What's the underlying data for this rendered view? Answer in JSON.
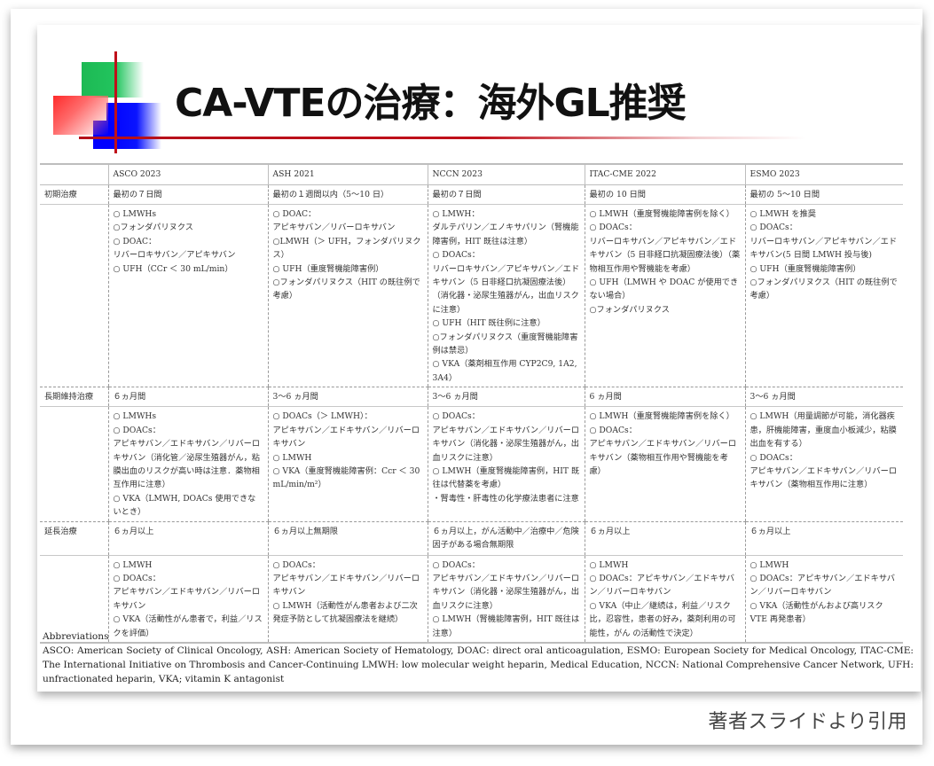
{
  "slide": {
    "title": "CA-VTEの治療：海外GL推奨",
    "colors": {
      "green": "#22c55e",
      "red": "#ff2b2b",
      "blue": "#0000ff",
      "rule": "#c0101a"
    }
  },
  "table": {
    "headers": [
      "",
      "ASCO 2023",
      "ASH 2021",
      "NCCN 2023",
      "ITAC-CME 2022",
      "ESMO 2023"
    ],
    "sections": [
      {
        "phase": "初期治療",
        "durations": [
          "最初の７日間",
          "最初の１週間以内（5～10 日）",
          "最初の７日間",
          "最初の 10 日間",
          "最初の 5～10 日間"
        ],
        "treatments": [
          [
            "○ LMWHs",
            "○フォンダパリヌクス",
            "○ DOAC：",
            "リバーロキサバン／アピキサバン",
            "○ UFH（CCr ＜ 30 mL/min）"
          ],
          [
            "○ DOAC：",
            "アピキサバン／リバーロキサバン",
            "○LMWH（＞ UFH，フォンダパリヌクス）",
            "○ UFH（重度腎機能障害例）",
            "○フォンダパリヌクス（HIT の既往例で考慮）"
          ],
          [
            "○ LMWH：",
            "ダルテパリン／エノキサパリン（腎機能障害例，HIT 既往は注意）",
            "○ DOACs：",
            "リバーロキサバン／アピキサバン／エドキサバン（5 日非経口抗凝固療法後）（消化器・泌尿生殖器がん，出血リスクに注意）",
            "○ UFH（HIT 既往例に注意）",
            "○フォンダパリヌクス（重度腎機能障害例は禁忌）",
            "○ VKA（薬剤相互作用 CYP2C9, 1A2, 3A4）"
          ],
          [
            "○ LMWH（重度腎機能障害例を除く）",
            "○ DOACs：",
            "リバーロキサバン／アピキサバン／エドキサバン（5 日非経口抗凝固療法後）（薬物相互作用や腎機能を考慮）",
            "○ UFH（LMWH や DOAC が使用できない場合）",
            "○フォンダパリヌクス"
          ],
          [
            "○ LMWH を推奨",
            "○ DOACs：",
            "リバーロキサバン／アピキサバン／エドキサバン(5 日間 LMWH 投与後)",
            "○ UFH（重度腎機能障害例）",
            "○フォンダパリヌクス（HIT の既往例で考慮）"
          ]
        ]
      },
      {
        "phase": "長期維持治療",
        "durations": [
          "６ヵ月間",
          "3～6 ヵ月間",
          "3～6 ヵ月間",
          "6 ヵ月間",
          "3～6 ヵ月間"
        ],
        "treatments": [
          [
            "○ LMWHs",
            "○ DOACs：",
            "アピキサバン／エドキサバン／リバーロキサバン（消化管／泌尿生殖器がん，粘膜出血のリスクが高い時は注意．薬物相互作用に注意）",
            "○ VKA（LMWH, DOACs 使用できないとき）"
          ],
          [
            "○ DOACs（＞ LMWH）：",
            "アピキサバン／エドキサバン／リバーロキサバン",
            "○ LMWH",
            "○ VKA（重度腎機能障害例：Ccr ＜ 30 mL/min/m²）"
          ],
          [
            "○ DOACs：",
            "アピキサバン／エドキサバン／リバーロキサバン（消化器・泌尿生殖器がん，出血リスクに注意）",
            "○ LMWH（重度腎機能障害例，HIT 既往は代替薬を考慮）",
            "・腎毒性・肝毒性の化学療法患者に注意"
          ],
          [
            "○ LMWH（重度腎機能障害例を除く）",
            "○ DOACs：",
            "アピキサバン／エドキサバン／リバーロキサバン（薬物相互作用や腎機能を考慮）"
          ],
          [
            "○ LMWH（用量調節が可能，消化器疾患，肝機能障害，重度血小板減少，粘膜出血を有する）",
            "○ DOACs：",
            "アピキサバン／エドキサバン／リバーロキサバン（薬物相互作用に注意）"
          ]
        ]
      },
      {
        "phase": "延長治療",
        "durations": [
          "６ヵ月以上",
          "６ヵ月以上無期限",
          "６ヵ月以上，がん活動中／治療中／危険因子がある場合無期限",
          "６ヵ月以上",
          "６ヵ月以上"
        ],
        "treatments": [
          [
            "○ LMWH",
            "○ DOACs：",
            "アピキサバン／エドキサバン／リバーロキサバン",
            "○ VKA（活動性がん患者で，利益／リスクを評価）"
          ],
          [
            "○ DOACs：",
            "アピキサバン／エドキサバン／リバーロキサバン",
            "○ LMWH（活動性がん患者および二次発症予防として抗凝固療法を継続）"
          ],
          [
            "○ DOACs：",
            "アピキサバン／エドキサバン／リバーロキサバン（消化器・泌尿生殖器がん，出血リスクに注意）",
            "○ LMWH（腎機能障害例，HIT 既往は注意）"
          ],
          [
            "○ LMWH",
            "○ DOACs：アピキサバン／エドキサバン／リバーロキサバン",
            "○ VKA（中止／継続は，利益／リスク比，忍容性，患者の好み，薬剤利用の可能性，がん の活動性で決定）"
          ],
          [
            "○ LMWH",
            "○ DOACs：アピキサバン／エドキサバン／リバーロキサバン",
            "○ VKA（活動性がんおよび高リスク VTE 再発患者）"
          ]
        ]
      }
    ]
  },
  "abbreviations": {
    "heading": "Abbreviations",
    "text": "ASCO: American Society of Clinical Oncology, ASH: American Society of Hematology, DOAC: direct oral anticoagulation, ESMO: European Society for Medical Oncology, ITAC-CME: The International Initiative on Thrombosis and Cancer-Continuing LMWH: low molecular weight heparin, Medical Education, NCCN: National Comprehensive Cancer Network, UFH: unfractionated heparin, VKA; vitamin K antagonist"
  },
  "citation": "著者スライドより引用"
}
